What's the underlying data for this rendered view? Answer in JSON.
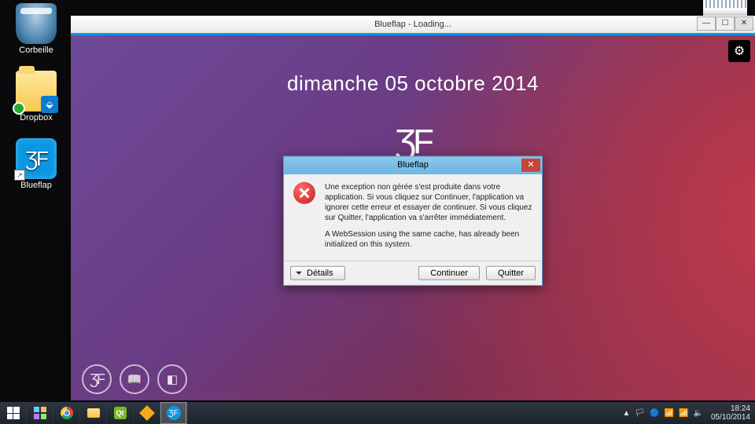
{
  "desktop": {
    "icons": [
      {
        "label": "Corbeille",
        "name": "desktop-icon-corbeille"
      },
      {
        "label": "Dropbox",
        "name": "desktop-icon-dropbox"
      },
      {
        "label": "Blueflap",
        "name": "desktop-icon-blueflap"
      }
    ]
  },
  "app": {
    "title": "Blueflap - Loading...",
    "date_header": "dimanche 05 octobre 2014",
    "logo_text": "ƷF",
    "search_placeholder": "",
    "dock": {
      "home": "ƷF",
      "book": "📖",
      "layout": "◧"
    }
  },
  "dialog": {
    "title": "Blueflap",
    "message_main": "Une exception non gérée s'est produite dans votre application. Si vous cliquez sur Continuer, l'application va ignorer cette erreur et essayer de continuer. Si vous cliquez sur Quitter, l'application va s'arrêter immédiatement.",
    "message_detail": "A WebSession using the same cache, has already been initialized on this system.",
    "buttons": {
      "details": "Détails",
      "continue": "Continuer",
      "quit": "Quitter"
    }
  },
  "taskbar": {
    "items": [
      "start",
      "apps",
      "chrome",
      "explorer",
      "qt",
      "plex",
      "blueflap"
    ],
    "tray_icons": [
      "▲",
      "🏳",
      "🔵",
      "📶",
      "📶",
      "🔈"
    ],
    "clock_time": "18:24",
    "clock_date": "05/10/2014"
  }
}
